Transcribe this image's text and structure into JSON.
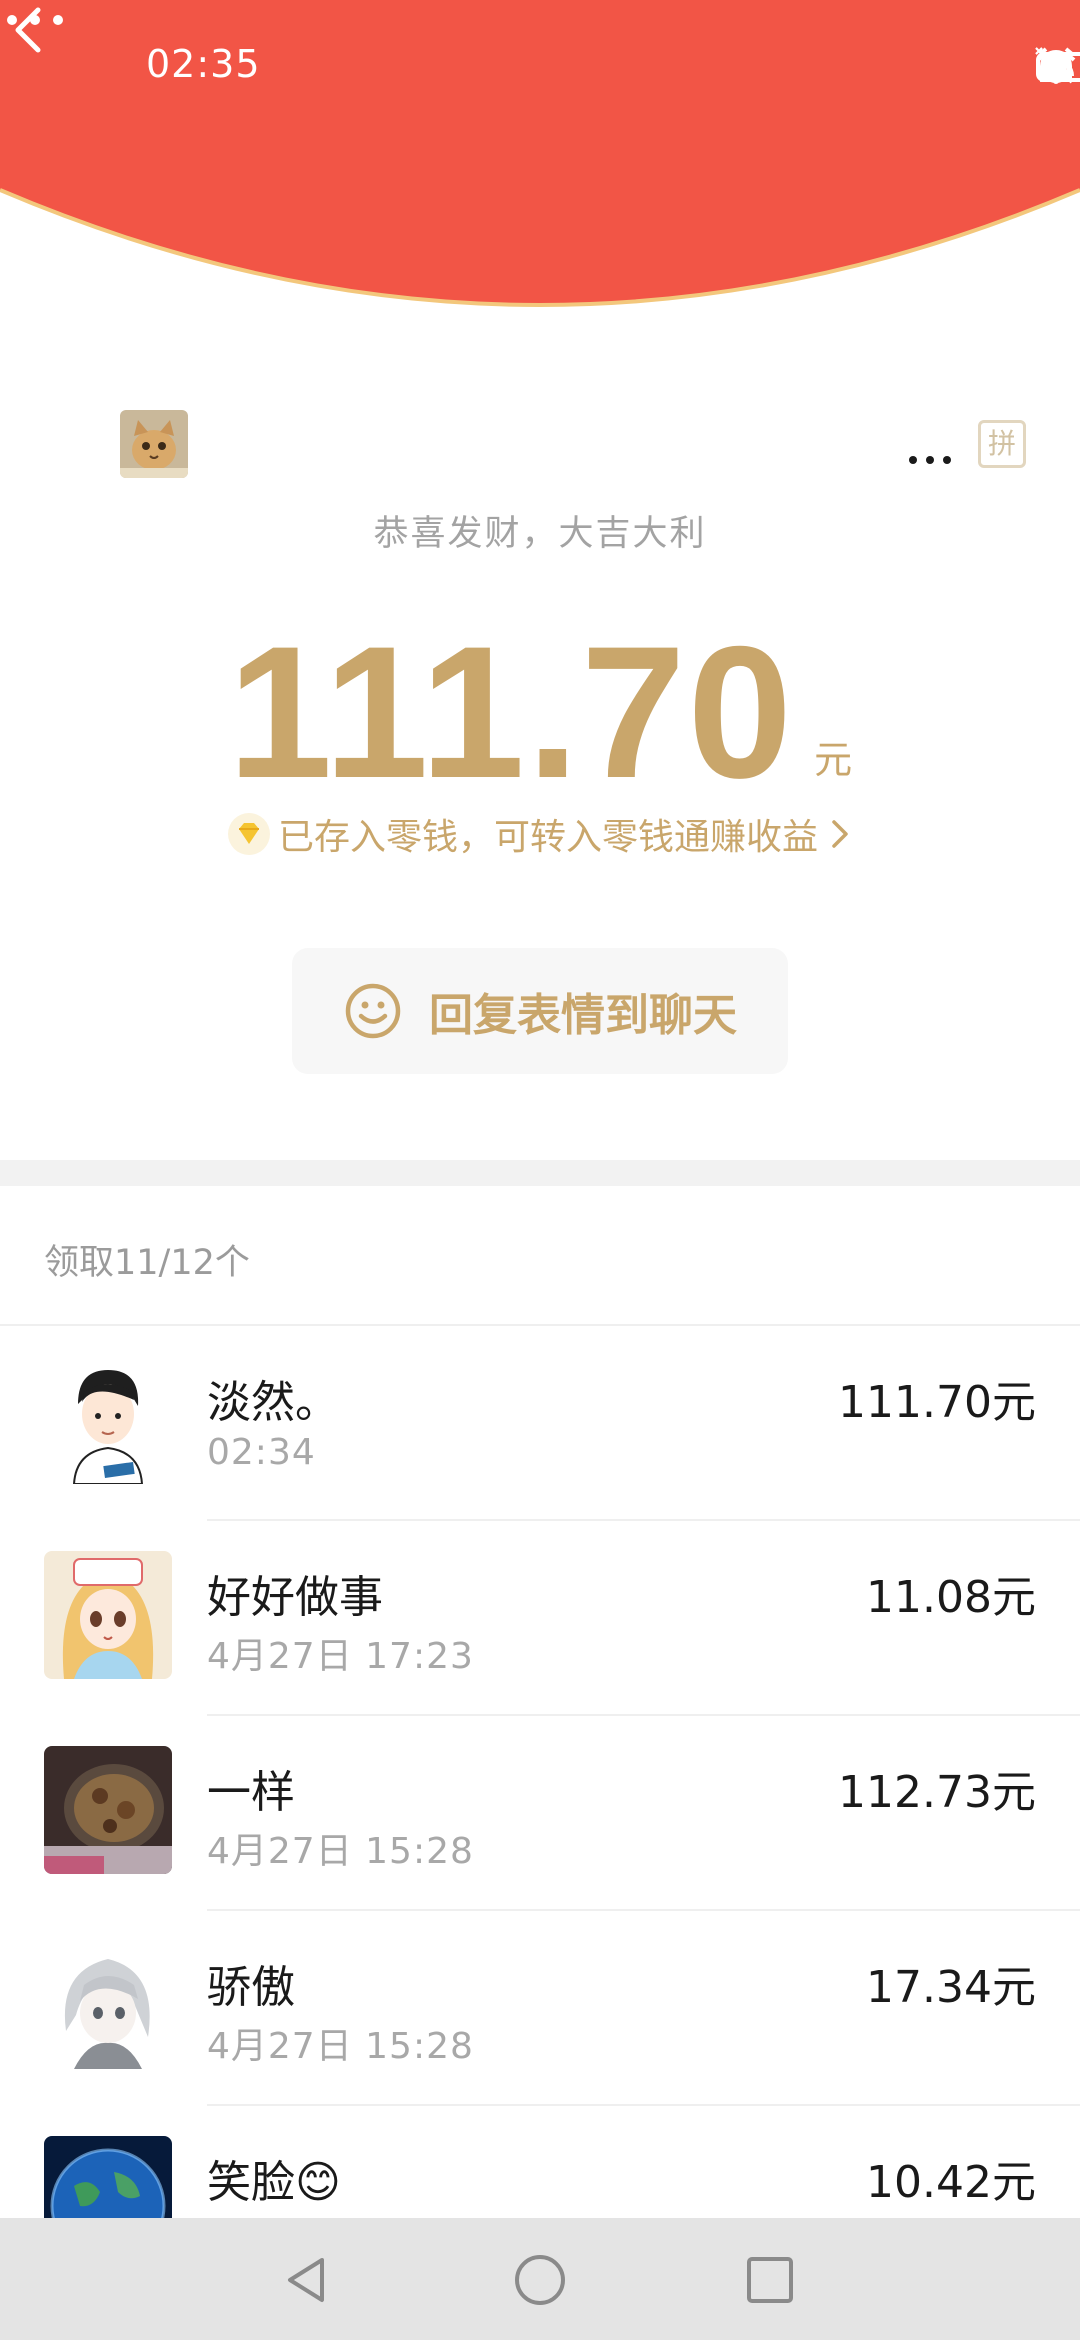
{
  "status_bar": {
    "time": "02:35",
    "icons": [
      "headphones-icon",
      "data-speed-icon",
      "alarm-icon",
      "mute-bell-icon",
      "wifi-icon",
      "signal-1-icon",
      "signal-2-icon",
      "battery-icon"
    ]
  },
  "nav": {
    "back_icon": "back-chevron-icon",
    "more_icon": "more-horizontal-icon"
  },
  "colors": {
    "header_red": "#f25546",
    "gold": "#c9a66b",
    "arc_edge": "#f3c77c"
  },
  "red_packet": {
    "blessing": "恭喜发财，大吉大利",
    "amount": "111.70",
    "unit": "元",
    "savings_note": "已存入零钱，可转入零钱通赚收益",
    "pin_label": "拼",
    "reply_label": "回复表情到聊天"
  },
  "summary": {
    "received_count": "领取11/12个"
  },
  "recipients": [
    {
      "name": "淡然。",
      "time": "02:34",
      "amount": "111.70元"
    },
    {
      "name": "好好做事",
      "time": "4月27日  17:23",
      "amount": "11.08元"
    },
    {
      "name": "一样",
      "time": "4月27日  15:28",
      "amount": "112.73元"
    },
    {
      "name": "骄傲",
      "time": "4月27日  15:28",
      "amount": "17.34元"
    },
    {
      "name": "笑脸😊",
      "time": "",
      "amount": "10.42元"
    }
  ],
  "system_nav": [
    "back-triangle-icon",
    "home-circle-icon",
    "recents-square-icon"
  ]
}
